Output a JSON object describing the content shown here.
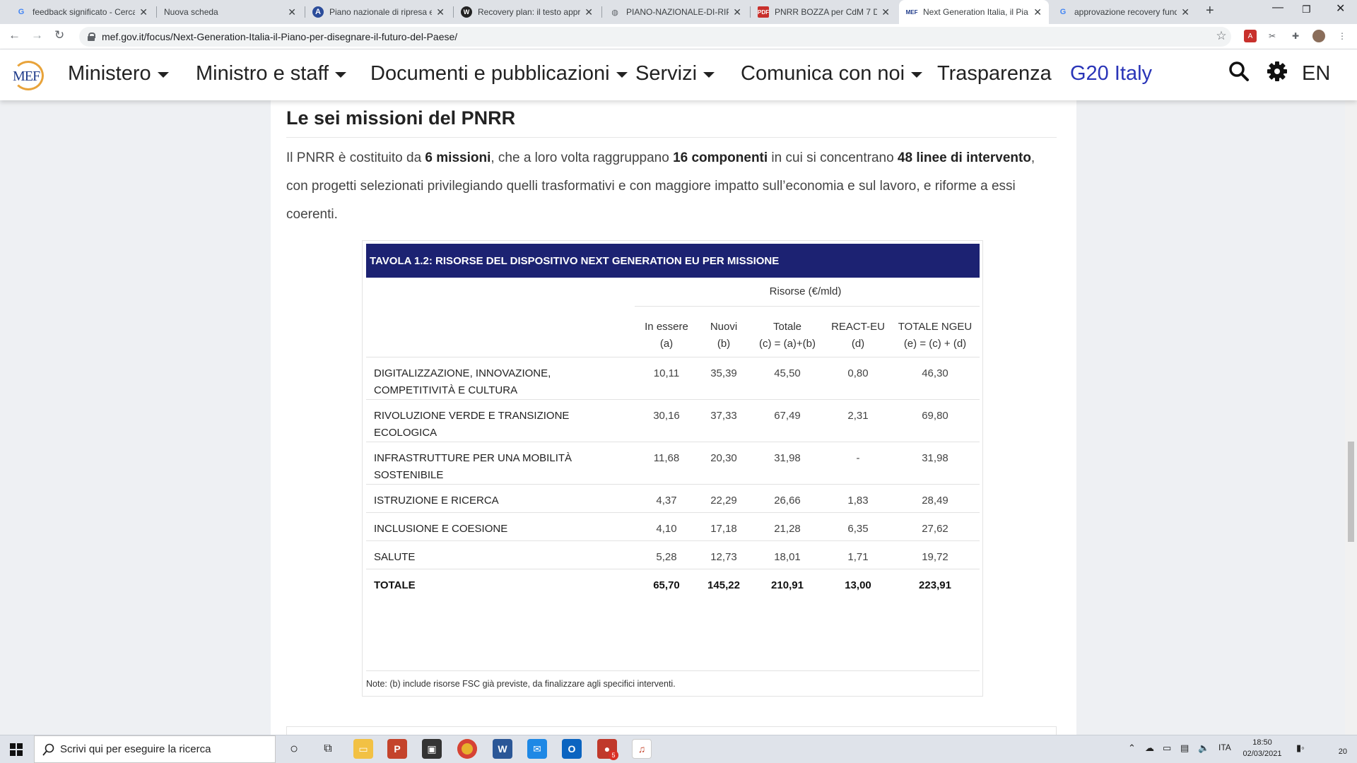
{
  "browser": {
    "tabs": [
      {
        "title": "feedback significato - Cerca",
        "favicon": "google-icon"
      },
      {
        "title": "Nuova scheda",
        "favicon": ""
      },
      {
        "title": "Piano nazionale di ripresa e",
        "favicon": "site-icon-a"
      },
      {
        "title": "Recovery plan: il testo appr",
        "favicon": "site-icon-w"
      },
      {
        "title": "PIANO-NAZIONALE-DI-RIP",
        "favicon": "globe-icon"
      },
      {
        "title": "PNRR BOZZA per CdM 7 Di",
        "favicon": "pdf-icon"
      },
      {
        "title": "Next Generation Italia, il Pia",
        "favicon": "mef-icon"
      },
      {
        "title": "approvazione recovery fund",
        "favicon": "google-icon"
      }
    ],
    "url": "mef.gov.it/focus/Next-Generation-Italia-il-Piano-per-disegnare-il-futuro-del-Paese/"
  },
  "site": {
    "logo_text": "MEF",
    "menu": [
      "Ministero",
      "Ministro e staff",
      "Documenti e pubblicazioni",
      "Servizi",
      "Comunica con noi",
      "Trasparenza",
      "G20 Italy"
    ],
    "lang": "EN"
  },
  "content": {
    "heading": "Le sei missioni del PNRR",
    "para": {
      "t1": "Il PNRR è costituito da ",
      "b1": "6 missioni",
      "t2": ", che a loro volta raggruppano ",
      "b2": "16 componenti",
      "t3": " in cui si concentrano ",
      "b3": "48 linee di intervento",
      "t4": ", con progetti selezionati privilegiando quelli trasformativi e con maggiore impatto sull’economia e sul lavoro, e riforme a essi coerenti."
    },
    "table": {
      "title": "TAVOLA 1.2: RISORSE DEL DISPOSITIVO NEXT GENERATION EU PER MISSIONE",
      "group_header": "Risorse (€/mld)",
      "columns": [
        {
          "l1": "In essere",
          "l2": "(a)"
        },
        {
          "l1": "Nuovi",
          "l2": "(b)"
        },
        {
          "l1": "Totale",
          "l2": "(c) = (a)+(b)"
        },
        {
          "l1": "REACT-EU",
          "l2": "(d)"
        },
        {
          "l1": "TOTALE NGEU",
          "l2": "(e) = (c) + (d)"
        }
      ],
      "rows": [
        {
          "l1": "DIGITALIZZAZIONE, INNOVAZIONE,",
          "l2": "COMPETITIVITÀ E CULTURA",
          "v": [
            "10,11",
            "35,39",
            "45,50",
            "0,80",
            "46,30"
          ]
        },
        {
          "l1": "RIVOLUZIONE VERDE E TRANSIZIONE",
          "l2": "ECOLOGICA",
          "v": [
            "30,16",
            "37,33",
            "67,49",
            "2,31",
            "69,80"
          ]
        },
        {
          "l1": "INFRASTRUTTURE PER UNA MOBILITÀ",
          "l2": "SOSTENIBILE",
          "v": [
            "11,68",
            "20,30",
            "31,98",
            "-",
            "31,98"
          ]
        },
        {
          "l1": "ISTRUZIONE E RICERCA",
          "l2": "",
          "v": [
            "4,37",
            "22,29",
            "26,66",
            "1,83",
            "28,49"
          ]
        },
        {
          "l1": "INCLUSIONE E COESIONE",
          "l2": "",
          "v": [
            "4,10",
            "17,18",
            "21,28",
            "6,35",
            "27,62"
          ]
        },
        {
          "l1": "SALUTE",
          "l2": "",
          "v": [
            "5,28",
            "12,73",
            "18,01",
            "1,71",
            "19,72"
          ]
        }
      ],
      "total": {
        "label": "TOTALE",
        "v": [
          "65,70",
          "145,22",
          "210,91",
          "13,00",
          "223,91"
        ]
      },
      "note": "Note: (b) include risorse FSC già previste, da finalizzare agli specifici interventi."
    }
  },
  "taskbar": {
    "search_placeholder": "Scrivi qui per eseguire la ricerca",
    "lang": "ITA",
    "time": "18:50",
    "date": "02/03/2021",
    "notif_count": "20",
    "badge": "5"
  },
  "colors": {
    "table_header": "#1c2272",
    "g20_link": "#2a35b8",
    "logo_ring": "#e8a33a"
  }
}
